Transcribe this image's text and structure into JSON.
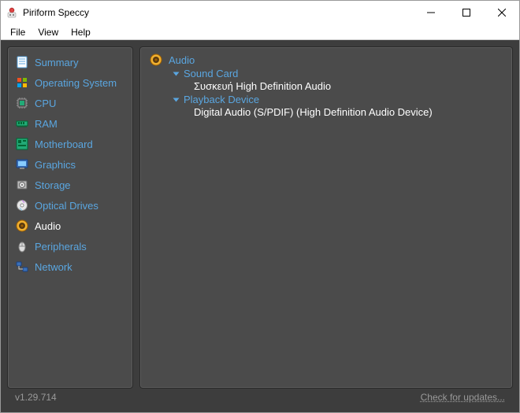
{
  "window": {
    "title": "Piriform Speccy"
  },
  "menu": {
    "file": "File",
    "view": "View",
    "help": "Help"
  },
  "sidebar": {
    "items": [
      {
        "id": "summary",
        "label": "Summary"
      },
      {
        "id": "os",
        "label": "Operating System"
      },
      {
        "id": "cpu",
        "label": "CPU"
      },
      {
        "id": "ram",
        "label": "RAM"
      },
      {
        "id": "motherboard",
        "label": "Motherboard"
      },
      {
        "id": "graphics",
        "label": "Graphics"
      },
      {
        "id": "storage",
        "label": "Storage"
      },
      {
        "id": "optical",
        "label": "Optical Drives"
      },
      {
        "id": "audio",
        "label": "Audio",
        "selected": true
      },
      {
        "id": "peripherals",
        "label": "Peripherals"
      },
      {
        "id": "network",
        "label": "Network"
      }
    ]
  },
  "content": {
    "section": "Audio",
    "groups": [
      {
        "heading": "Sound Card",
        "value": "Συσκευή High Definition Audio"
      },
      {
        "heading": "Playback Device",
        "value": "Digital Audio (S/PDIF) (High Definition Audio Device)"
      }
    ]
  },
  "status": {
    "version": "v1.29.714",
    "updates": "Check for updates..."
  }
}
